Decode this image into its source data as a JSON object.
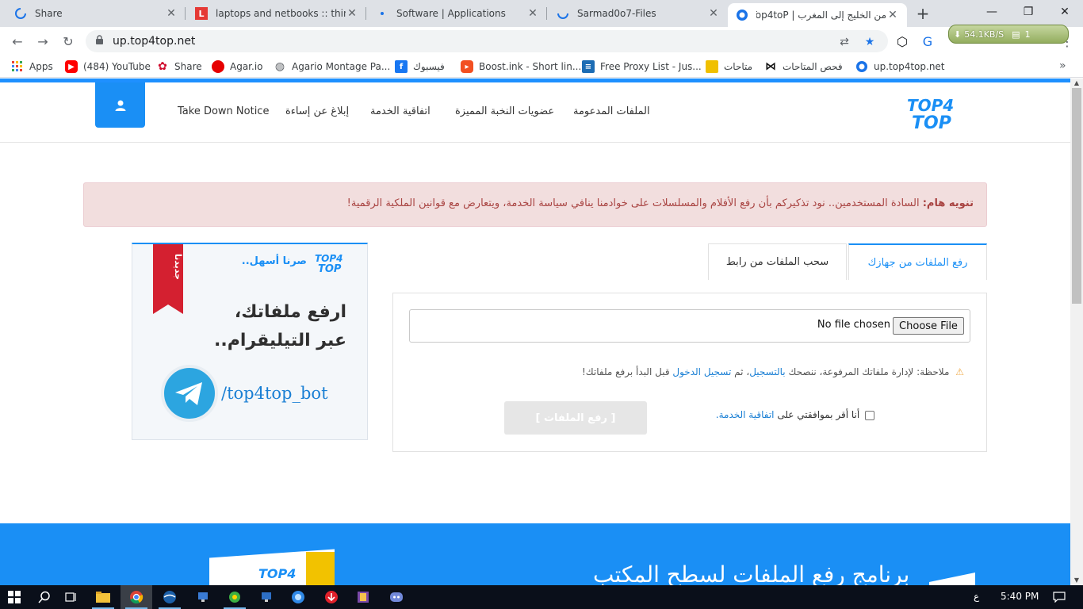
{
  "browser": {
    "tabs": [
      {
        "title": "Share",
        "icon": "loading-spinner-icon",
        "color": "#1a73e8"
      },
      {
        "title": "laptops and netbooks :: thinkp",
        "icon": "L",
        "color": "#e53935"
      },
      {
        "title": "Software | Applications",
        "icon": "dot",
        "color": "#1a73e8"
      },
      {
        "title": "Sarmad0o7-Files",
        "icon": "loading-spinner-icon",
        "color": "#1a73e8"
      },
      {
        "title": "من الخليج إلى المغرب | Top4toP",
        "icon": "top4top-favicon",
        "color": "#1a73e8"
      }
    ],
    "url": "up.top4top.net",
    "extension": {
      "speed": "54.1KB/S",
      "count": "1"
    },
    "bookmarks": [
      {
        "label": "Apps",
        "icon": "apps-grid-icon",
        "color": "#ea4335"
      },
      {
        "label": "(484) YouTube",
        "icon": "youtube-icon",
        "color": "#ff0000"
      },
      {
        "label": "Share",
        "icon": "huawei-icon",
        "color": "#cf0a2c"
      },
      {
        "label": "Agar.io",
        "icon": "agario-icon",
        "color": "#e60000"
      },
      {
        "label": "Agario Montage Pa...",
        "icon": "globe-icon",
        "color": "#5f6368"
      },
      {
        "label": "فيسبوك",
        "icon": "facebook-icon",
        "color": "#1877f2"
      },
      {
        "label": "Boost.ink - Short lin...",
        "icon": "boost-icon",
        "color": "#f25022"
      },
      {
        "label": "Free Proxy List - Jus...",
        "icon": "proxy-list-icon",
        "color": "#1c6cb4"
      },
      {
        "label": "متاحات",
        "icon": "folder-icon",
        "color": "#f0c000"
      },
      {
        "label": "فحص المتاحات",
        "icon": "bow-icon",
        "color": "#111111"
      },
      {
        "label": "up.top4top.net",
        "icon": "top4top-favicon",
        "color": "#1a73e8"
      }
    ]
  },
  "site": {
    "nav": [
      "Take Down Notice",
      "إبلاغ عن إساءة",
      "اتفاقية الخدمة",
      "عضويات النخبة المميزة",
      "الملفات المدعومة"
    ],
    "logo_line1": "TOP4",
    "logo_line2": "TOP",
    "alert_bold": "تنويه هام:",
    "alert_text": "السادة المستخدمين.. نود تذكيركم بأن رفع الأفلام والمسلسلات على خوادمنا ينافي سياسة الخدمة، ويتعارض مع قوانين الملكية الرقمية!",
    "promo": {
      "ribbon": "جديدنا",
      "tagline": "صرنا أسهل..",
      "headline_1": "ارفع ملفاتك،",
      "headline_2": "عبر التيليقرام..",
      "bot": "/top4top_bot"
    },
    "upload_tabs": [
      "رفع الملفات من جهازك",
      "سحب الملفات من رابط"
    ],
    "file_input": {
      "no_file": "No file chosen",
      "choose": "Choose File"
    },
    "note": {
      "prefix": "ملاحظة: لإدارة ملفاتك المرفوعة، ننصحك",
      "register": "بالتسجيل",
      "middle": "، ثم",
      "login": "تسجيل الدخول",
      "suffix": "قبل البدأ برفع ملفاتك!"
    },
    "agree": {
      "text": "أنا أقر بموافقتي على",
      "link": "اتفاقية الخدمة."
    },
    "upload_button": "[ رفع الملفات ]",
    "footer_title": "برنامج رفع الملفات لسطح المكتب"
  },
  "taskbar": {
    "lang": "ع",
    "time": "5:40 PM"
  },
  "colors": {
    "brand": "#1a8ff5",
    "alert_bg": "#f2dede",
    "alert_text": "#a94442"
  }
}
